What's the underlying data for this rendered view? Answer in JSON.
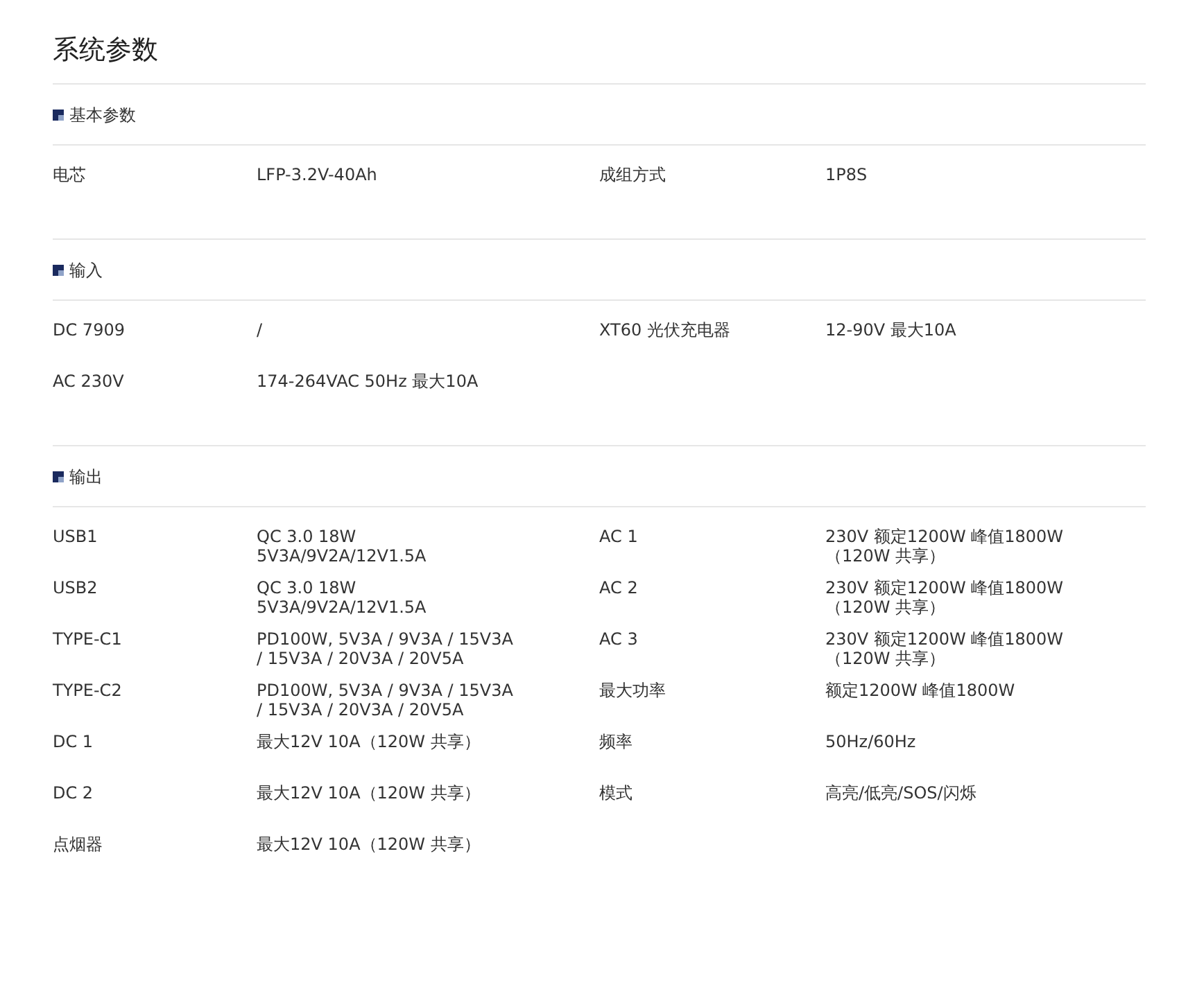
{
  "title": "系统参数",
  "sections": [
    {
      "heading": "基本参数",
      "items": [
        {
          "label": "电芯",
          "value": "LFP-3.2V-40Ah"
        },
        {
          "label": "成组方式",
          "value": "1P8S"
        }
      ]
    },
    {
      "heading": "输入",
      "items": [
        {
          "label": "DC 7909",
          "value": "/"
        },
        {
          "label": "XT60 光伏充电器",
          "value": "12-90V 最大10A"
        },
        {
          "label": "AC 230V",
          "value": "174-264VAC 50Hz 最大10A"
        }
      ]
    },
    {
      "heading": "输出",
      "items": [
        {
          "label": "USB1",
          "value": "QC 3.0 18W 5V3A/9V2A/12V1.5A"
        },
        {
          "label": "AC 1",
          "value": "230V 额定1200W 峰值1800W（120W 共享）"
        },
        {
          "label": "USB2",
          "value": "QC 3.0 18W 5V3A/9V2A/12V1.5A"
        },
        {
          "label": "AC 2",
          "value": "230V 额定1200W 峰值1800W（120W 共享）"
        },
        {
          "label": "TYPE-C1",
          "value": "PD100W, 5V3A / 9V3A / 15V3A / 15V3A / 20V3A / 20V5A"
        },
        {
          "label": "AC 3",
          "value": "230V 额定1200W 峰值1800W（120W 共享）"
        },
        {
          "label": "TYPE-C2",
          "value": "PD100W, 5V3A / 9V3A / 15V3A / 15V3A / 20V3A / 20V5A"
        },
        {
          "label": "最大功率",
          "value": "额定1200W 峰值1800W"
        },
        {
          "label": "DC 1",
          "value": "最大12V 10A（120W 共享）"
        },
        {
          "label": "频率",
          "value": "50Hz/60Hz"
        },
        {
          "label": "DC 2",
          "value": "最大12V 10A（120W 共享）"
        },
        {
          "label": "模式",
          "value": "高亮/低亮/SOS/闪烁"
        },
        {
          "label": "点烟器",
          "value": "最大12V 10A（120W 共享）"
        }
      ]
    }
  ]
}
